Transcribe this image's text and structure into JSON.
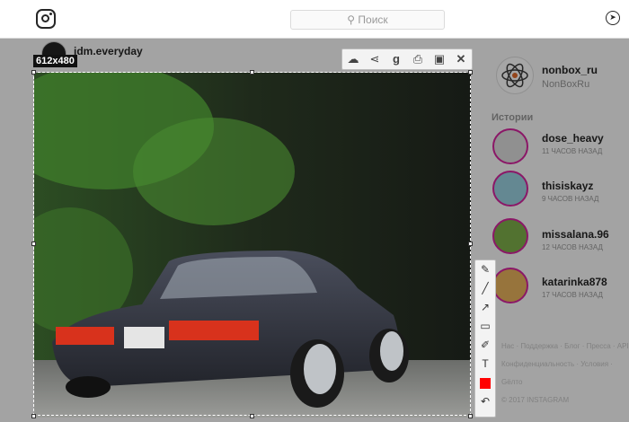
{
  "header": {
    "search_placeholder": "Поиск",
    "logo_icon": "instagram-logo-icon",
    "compass_icon": "compass-icon"
  },
  "post": {
    "username": "jdm.everyday",
    "size_label": "612x480"
  },
  "toolbar": {
    "icons": [
      "cloud-upload-icon",
      "share-icon",
      "google-icon",
      "print-icon",
      "save-icon",
      "close-icon"
    ]
  },
  "sidetools": {
    "icons": [
      "pen-icon",
      "line-icon",
      "arrow-icon",
      "rectangle-icon",
      "marker-icon",
      "text-icon",
      "color-icon",
      "undo-icon"
    ],
    "color": "#ff0000"
  },
  "profile": {
    "name": "nonbox_ru",
    "sub": "NonBoxRu"
  },
  "stories": {
    "title": "Истории",
    "items": [
      {
        "name": "dose_heavy",
        "time": "11 ЧАСОВ НАЗАД"
      },
      {
        "name": "thisiskayz",
        "time": "9 ЧАСОВ НАЗАД"
      },
      {
        "name": "missalana.96",
        "time": "12 ЧАСОВ НАЗАД"
      },
      {
        "name": "katarinka878",
        "time": "17 ЧАСОВ НАЗАД"
      }
    ]
  },
  "footer": {
    "line1": "Нас · Поддержка · Блог · Пресса · API",
    "line2": "Конфиденциальность · Условия · Gёлтo",
    "line3": "© 2017 INSTAGRAM"
  }
}
